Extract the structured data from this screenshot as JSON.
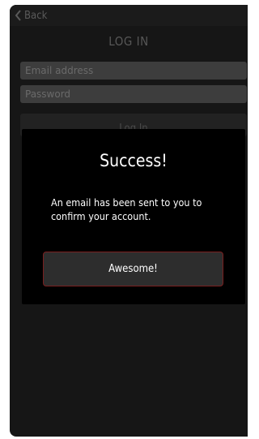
{
  "header": {
    "back_label": "Back",
    "title": "LOG IN"
  },
  "form": {
    "email_placeholder": "Email address",
    "password_placeholder": "Password",
    "login_label": "Log In"
  },
  "dialog": {
    "title": "Success!",
    "message": "An email has been sent to you to confirm your account.",
    "button_label": "Awesome!"
  },
  "colors": {
    "background": "#161616",
    "dialog": "#000000",
    "button_border": "#7a1f1f"
  },
  "icons": {
    "back": "chevron-left-icon"
  }
}
